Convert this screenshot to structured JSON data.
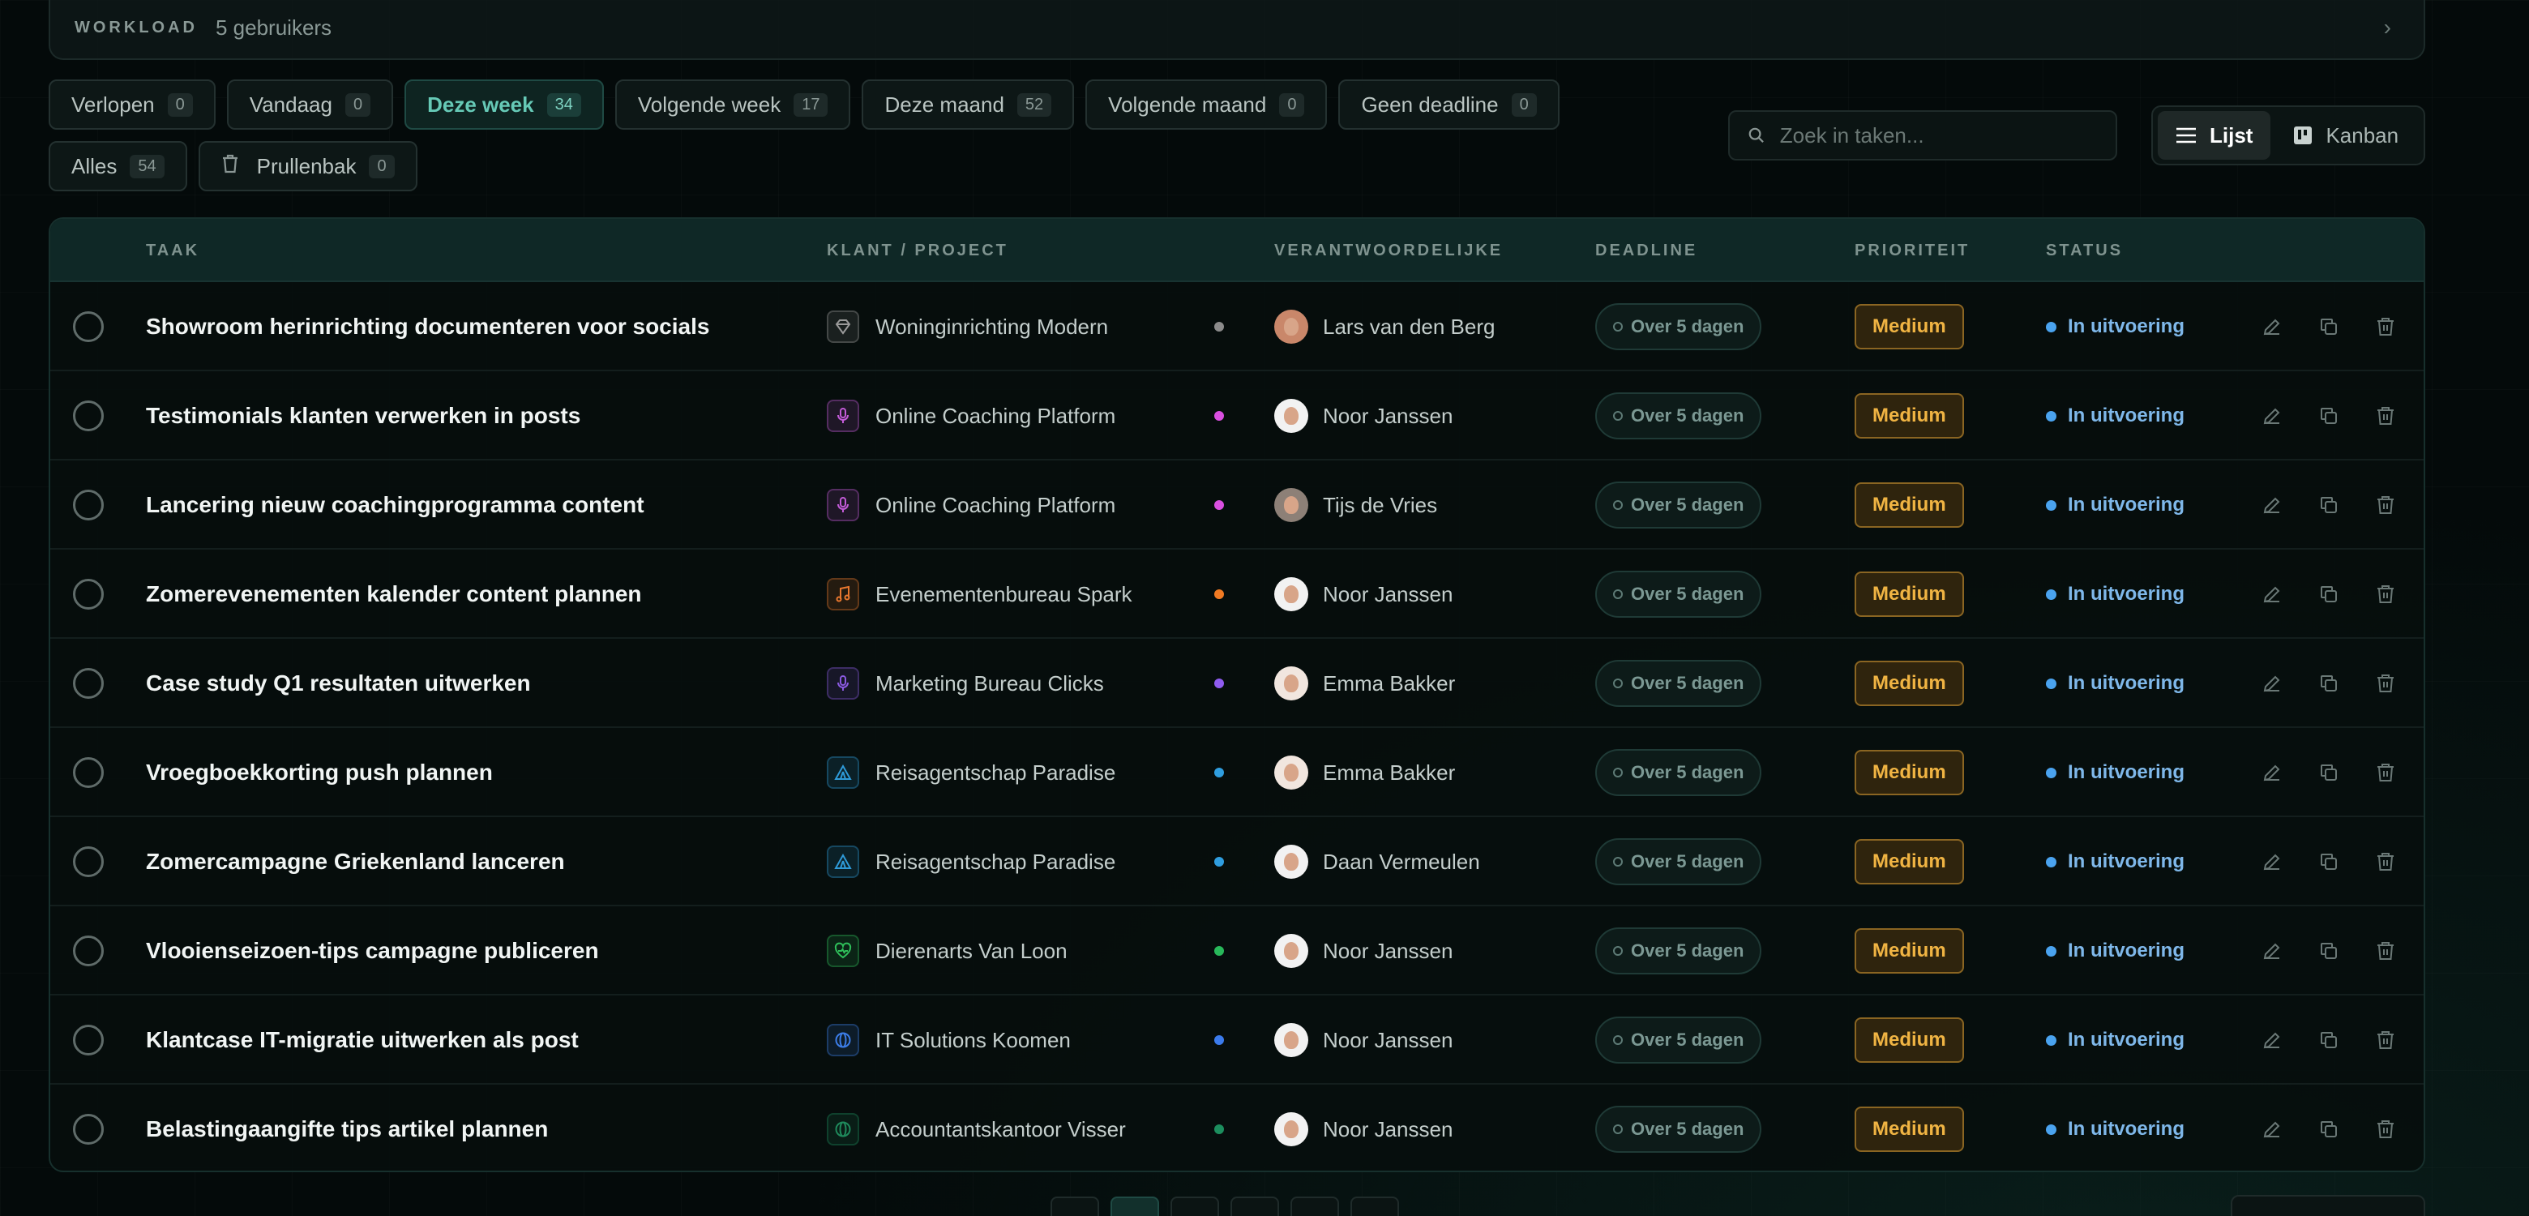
{
  "workload": {
    "label": "WORKLOAD",
    "count": "5 gebruikers",
    "chevron": "›"
  },
  "filters": [
    {
      "label": "Verlopen",
      "count": "0",
      "active": false
    },
    {
      "label": "Vandaag",
      "count": "0",
      "active": false
    },
    {
      "label": "Deze week",
      "count": "34",
      "active": true
    },
    {
      "label": "Volgende week",
      "count": "17",
      "active": false
    },
    {
      "label": "Deze maand",
      "count": "52",
      "active": false
    },
    {
      "label": "Volgende maand",
      "count": "0",
      "active": false
    },
    {
      "label": "Geen deadline",
      "count": "0",
      "active": false
    },
    {
      "label": "Alles",
      "count": "54",
      "active": false
    },
    {
      "label": "Prullenbak",
      "count": "0",
      "active": false,
      "icon": "trash-icon"
    }
  ],
  "search": {
    "placeholder": "Zoek in taken..."
  },
  "views": [
    {
      "label": "Lijst",
      "icon": "list-icon",
      "active": true
    },
    {
      "label": "Kanban",
      "icon": "kanban-icon",
      "active": false
    }
  ],
  "table": {
    "headers": {
      "task": "TAAK",
      "client": "KLANT / PROJECT",
      "owner": "VERANTWOORDELIJKE",
      "deadline": "DEADLINE",
      "priority": "PRIORITEIT",
      "status": "STATUS"
    },
    "rows": [
      {
        "task": "Showroom herinrichting documenteren voor socials",
        "client": "Woninginrichting Modern",
        "client_icon": "diamond-icon",
        "client_color": "#9a9a9a",
        "dot_color": "#8b8b8b",
        "owner": "Lars van den Berg",
        "avatar_bg": "#c9876a",
        "deadline": "Over 5 dagen",
        "priority": "Medium",
        "status": "In uitvoering"
      },
      {
        "task": "Testimonials klanten verwerken in posts",
        "client": "Online Coaching Platform",
        "client_icon": "microphone-icon",
        "client_color": "#c35bd8",
        "dot_color": "#d94fe0",
        "owner": "Noor Janssen",
        "avatar_bg": "#f2f2f2",
        "deadline": "Over 5 dagen",
        "priority": "Medium",
        "status": "In uitvoering"
      },
      {
        "task": "Lancering nieuw coachingprogramma content",
        "client": "Online Coaching Platform",
        "client_icon": "microphone-icon",
        "client_color": "#c35bd8",
        "dot_color": "#d94fe0",
        "owner": "Tijs de Vries",
        "avatar_bg": "#8d8077",
        "deadline": "Over 5 dagen",
        "priority": "Medium",
        "status": "In uitvoering"
      },
      {
        "task": "Zomerevenementen kalender content plannen",
        "client": "Evenementenbureau Spark",
        "client_icon": "music-icon",
        "client_color": "#e8772e",
        "dot_color": "#f07a23",
        "owner": "Noor Janssen",
        "avatar_bg": "#f2f2f2",
        "deadline": "Over 5 dagen",
        "priority": "Medium",
        "status": "In uitvoering"
      },
      {
        "task": "Case study Q1 resultaten uitwerken",
        "client": "Marketing Bureau Clicks",
        "client_icon": "microphone-icon",
        "client_color": "#8a5ae0",
        "dot_color": "#8f5cf0",
        "owner": "Emma Bakker",
        "avatar_bg": "#f1e6df",
        "deadline": "Over 5 dagen",
        "priority": "Medium",
        "status": "In uitvoering"
      },
      {
        "task": "Vroegboekkorting push plannen",
        "client": "Reisagentschap Paradise",
        "client_icon": "tent-icon",
        "client_color": "#2e9ad8",
        "dot_color": "#2f9ee0",
        "owner": "Emma Bakker",
        "avatar_bg": "#f1e6df",
        "deadline": "Over 5 dagen",
        "priority": "Medium",
        "status": "In uitvoering"
      },
      {
        "task": "Zomercampagne Griekenland lanceren",
        "client": "Reisagentschap Paradise",
        "client_icon": "tent-icon",
        "client_color": "#2e9ad8",
        "dot_color": "#2f9ee0",
        "owner": "Daan Vermeulen",
        "avatar_bg": "#f2f2f2",
        "deadline": "Over 5 dagen",
        "priority": "Medium",
        "status": "In uitvoering"
      },
      {
        "task": "Vlooienseizoen-tips campagne publiceren",
        "client": "Dierenarts Van Loon",
        "client_icon": "heart-pulse-icon",
        "client_color": "#2fbf5a",
        "dot_color": "#28b85a",
        "owner": "Noor Janssen",
        "avatar_bg": "#f2f2f2",
        "deadline": "Over 5 dagen",
        "priority": "Medium",
        "status": "In uitvoering"
      },
      {
        "task": "Klantcase IT-migratie uitwerken als post",
        "client": "IT Solutions Koomen",
        "client_icon": "globe-icon",
        "client_color": "#3c7de8",
        "dot_color": "#3b7bec",
        "owner": "Noor Janssen",
        "avatar_bg": "#f2f2f2",
        "deadline": "Over 5 dagen",
        "priority": "Medium",
        "status": "In uitvoering"
      },
      {
        "task": "Belastingaangifte tips artikel plannen",
        "client": "Accountantskantoor Visser",
        "client_icon": "globe-icon",
        "client_color": "#1f8a5c",
        "dot_color": "#1c8e5e",
        "owner": "Noor Janssen",
        "avatar_bg": "#f2f2f2",
        "deadline": "Over 5 dagen",
        "priority": "Medium",
        "status": "In uitvoering"
      }
    ]
  }
}
